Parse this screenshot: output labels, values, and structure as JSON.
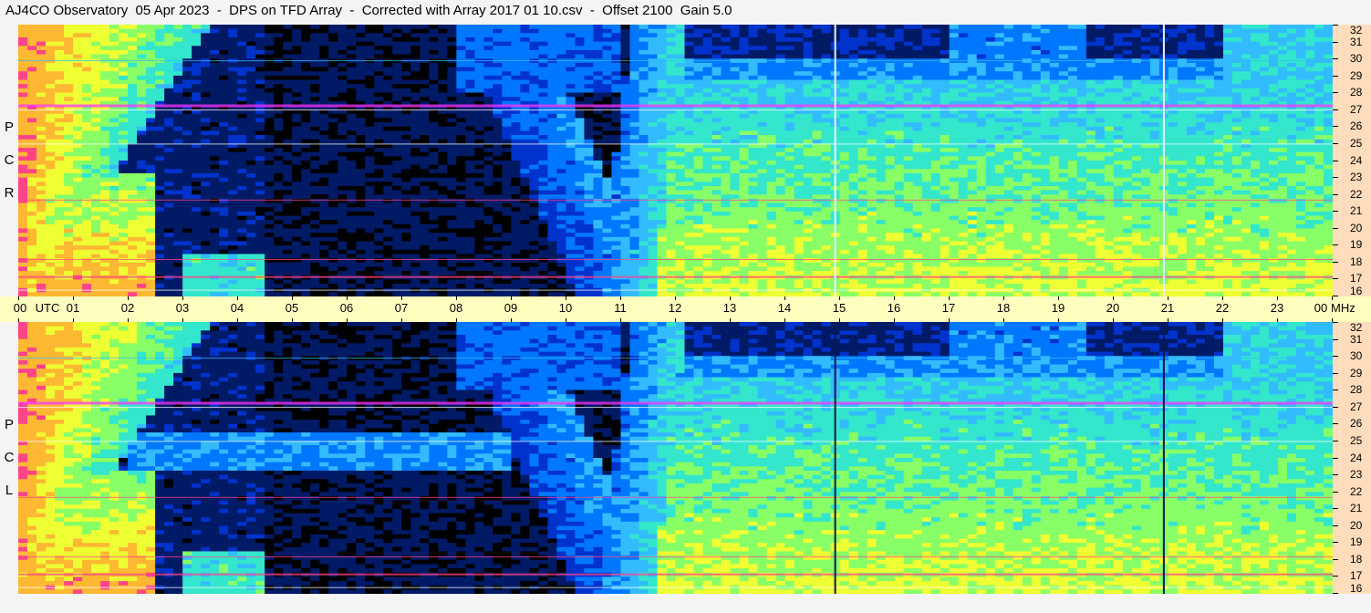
{
  "title": "AJ4CO Observatory  05 Apr 2023  -  DPS on TFD Array  -  Corrected with Array 2017 01 10.csv  -  Offset 2100  Gain 5.0",
  "chart_data": [
    {
      "type": "heatmap",
      "name": "RCP",
      "side_label": [
        "R",
        "C",
        "P"
      ],
      "x_label": "UTC",
      "x_ticks": [
        "00",
        "01",
        "02",
        "03",
        "04",
        "05",
        "06",
        "07",
        "08",
        "09",
        "10",
        "11",
        "12",
        "13",
        "14",
        "15",
        "16",
        "17",
        "18",
        "19",
        "20",
        "21",
        "22",
        "23",
        "00"
      ],
      "y_unit": "MHz",
      "y_ticks": [
        16,
        17,
        18,
        19,
        20,
        21,
        22,
        23,
        24,
        25,
        26,
        27,
        28,
        29,
        30,
        31,
        32
      ],
      "ylim": [
        16,
        32
      ]
    },
    {
      "type": "heatmap",
      "name": "LCP",
      "side_label": [
        "L",
        "C",
        "P"
      ],
      "x_label": "UTC",
      "x_ticks": [
        "00",
        "01",
        "02",
        "03",
        "04",
        "05",
        "06",
        "07",
        "08",
        "09",
        "10",
        "11",
        "12",
        "13",
        "14",
        "15",
        "16",
        "17",
        "18",
        "19",
        "20",
        "21",
        "22",
        "23",
        "00"
      ],
      "y_unit": "MHz",
      "y_ticks": [
        16,
        17,
        18,
        19,
        20,
        21,
        22,
        23,
        24,
        25,
        26,
        27,
        28,
        29,
        30,
        31,
        32
      ],
      "ylim": [
        16,
        32
      ]
    }
  ],
  "axis_text": {
    "utc": "UTC",
    "mhz": "MHz"
  },
  "colors": {
    "background": "#f4f4f4",
    "freq_axis_bg": "#ffdcbc",
    "time_axis_bg": "#ffffc0",
    "colormap": [
      "#000000",
      "#001a66",
      "#0033cc",
      "#0077ff",
      "#33bbff",
      "#33e6cc",
      "#88ff66",
      "#eeff33",
      "#ffb833",
      "#ff4488",
      "#ff33ff",
      "#ffffff"
    ]
  }
}
